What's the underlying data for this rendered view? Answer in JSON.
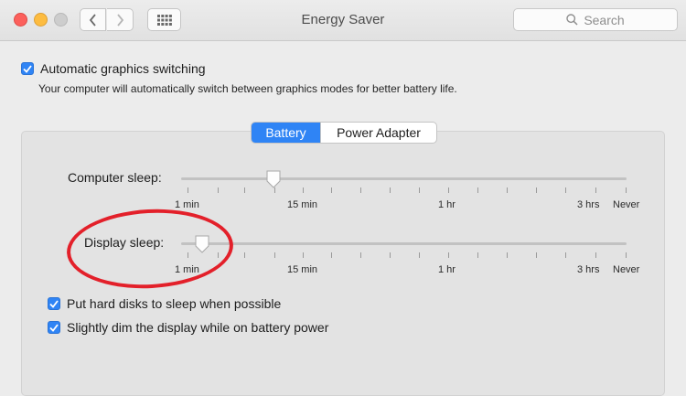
{
  "window": {
    "title": "Energy Saver",
    "search_placeholder": "Search"
  },
  "graphics": {
    "label": "Automatic graphics switching",
    "checked": true,
    "description": "Your computer will automatically switch between graphics modes for better battery life."
  },
  "tabs": [
    {
      "label": "Battery",
      "active": true
    },
    {
      "label": "Power Adapter",
      "active": false
    }
  ],
  "sliders": {
    "computer_sleep": {
      "label": "Computer sleep:",
      "value": "15 min"
    },
    "display_sleep": {
      "label": "Display sleep:",
      "value": "2 min"
    },
    "scale": [
      "1 min",
      "15 min",
      "1 hr",
      "3 hrs",
      "Never"
    ]
  },
  "options": [
    {
      "label": "Put hard disks to sleep when possible",
      "checked": true
    },
    {
      "label": "Slightly dim the display while on battery power",
      "checked": true
    }
  ],
  "colors": {
    "accent": "#2f84f5",
    "highlight_ring": "#e3202a"
  },
  "icons": [
    "back-icon",
    "forward-icon",
    "grid-icon",
    "search-icon",
    "checkmark-icon"
  ]
}
